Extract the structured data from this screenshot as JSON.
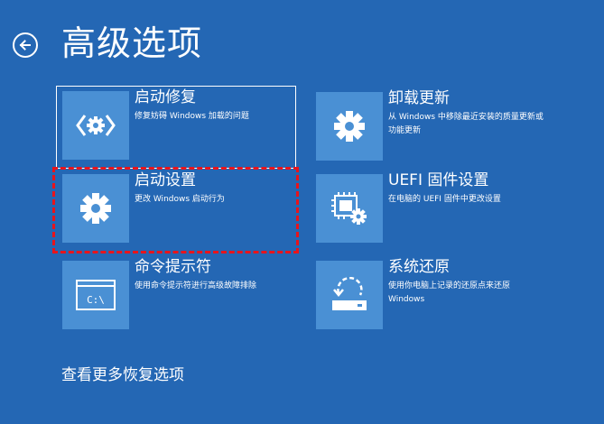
{
  "page": {
    "title": "高级选项",
    "back_icon": "back-arrow-icon",
    "more_options": "查看更多恢复选项"
  },
  "colors": {
    "background": "#2467b4",
    "tile_icon_bg": "#4a90d4",
    "highlight": "#e8141c"
  },
  "tiles": [
    {
      "title": "启动修复",
      "desc": "修复妨碍 Windows 加载的问题",
      "icon": "startup-repair-icon"
    },
    {
      "title": "卸载更新",
      "desc": "从 Windows 中移除最近安装的质量更新或功能更新",
      "icon": "gear-icon"
    },
    {
      "title": "启动设置",
      "desc": "更改 Windows 启动行为",
      "icon": "gear-icon"
    },
    {
      "title": "UEFI 固件设置",
      "desc": "在电脑的 UEFI 固件中更改设置",
      "icon": "firmware-chip-icon"
    },
    {
      "title": "命令提示符",
      "desc": "使用命令提示符进行高级故障排除",
      "icon": "command-prompt-icon",
      "icon_text": "C:\\"
    },
    {
      "title": "系统还原",
      "desc": "使用你电脑上记录的还原点来还原 Windows",
      "icon": "system-restore-icon"
    }
  ]
}
